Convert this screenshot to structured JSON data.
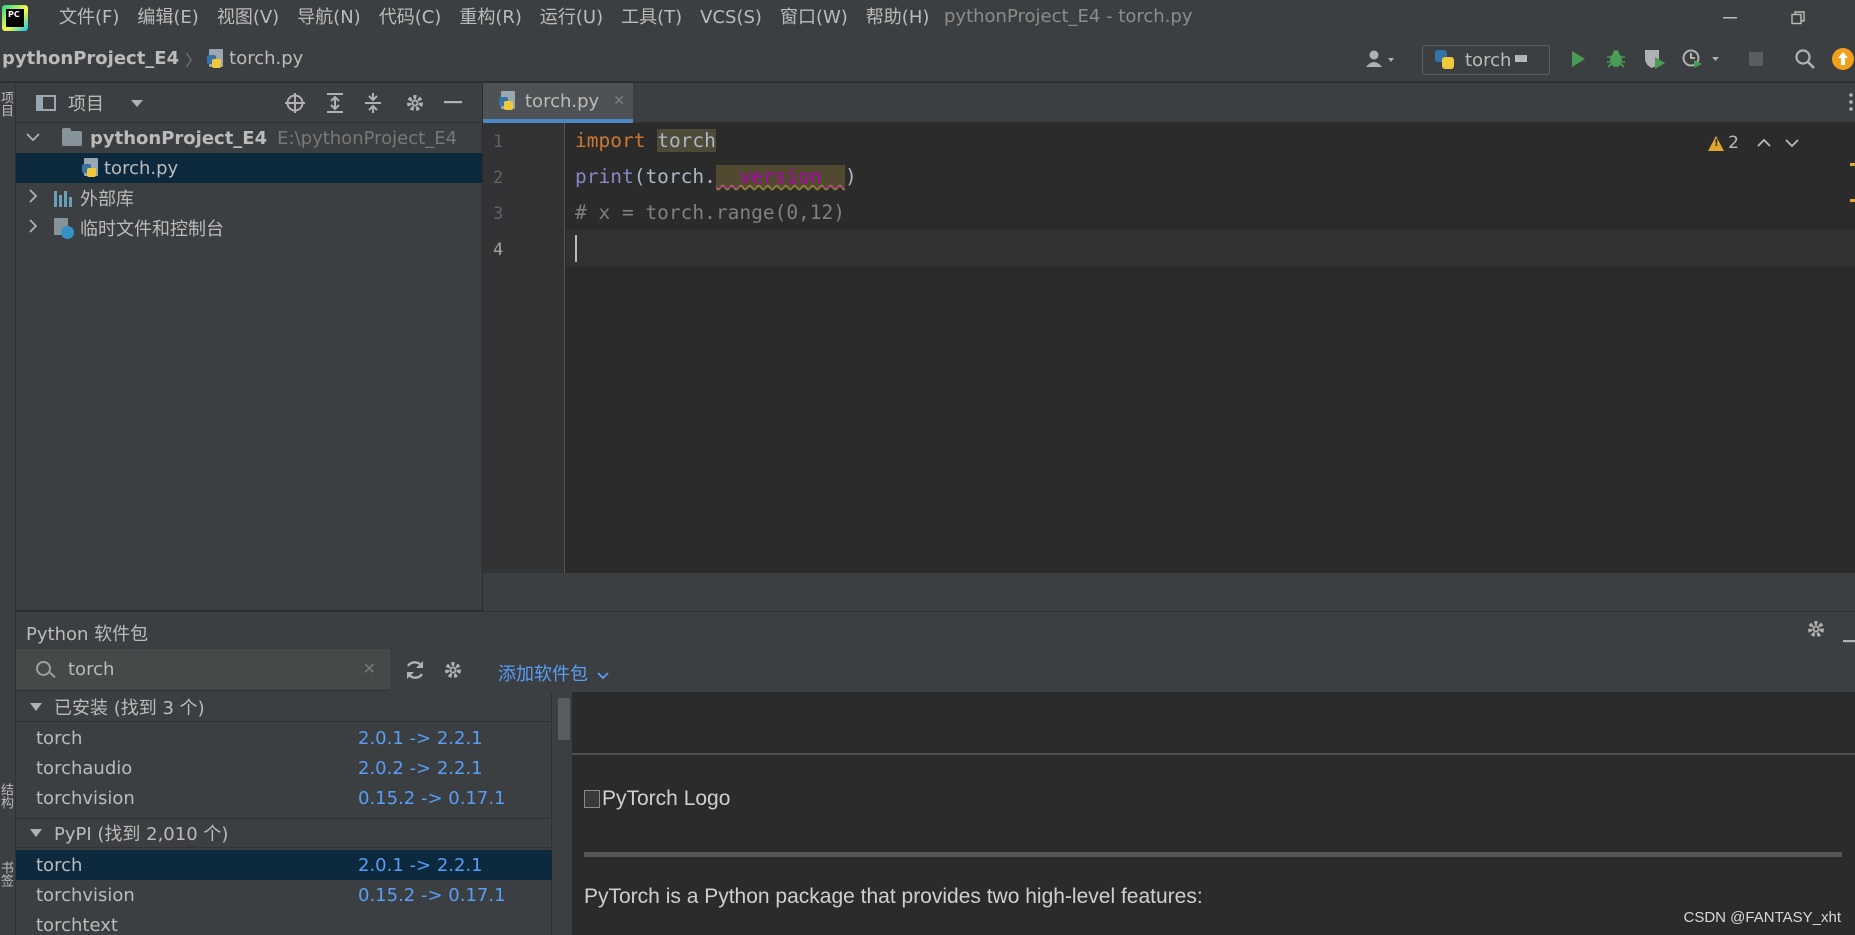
{
  "menubar": {
    "logo_text": "PC",
    "items": [
      "文件(F)",
      "编辑(E)",
      "视图(V)",
      "导航(N)",
      "代码(C)",
      "重构(R)",
      "运行(U)",
      "工具(T)",
      "VCS(S)",
      "窗口(W)",
      "帮助(H)"
    ],
    "window_title": "pythonProject_E4 - torch.py"
  },
  "navbar": {
    "project": "pythonProject_E4",
    "file": "torch.py",
    "run_config": "torch"
  },
  "left_strip": {
    "top_tab": "项目",
    "bottom_tab_1": "结构",
    "bottom_tab_2": "书签"
  },
  "project_panel": {
    "title": "项目",
    "root_name": "pythonProject_E4",
    "root_path": "E:\\pythonProject_E4",
    "file": "torch.py",
    "external_libs": "外部库",
    "scratches": "临时文件和控制台"
  },
  "editor": {
    "tab_name": "torch.py",
    "line_numbers": [
      "1",
      "2",
      "3",
      "4"
    ],
    "line1": {
      "kw": "import",
      "space": " ",
      "mod": "torch"
    },
    "line2": {
      "fn": "print",
      "open": "(torch.",
      "dunder": "__version__",
      "close": ")"
    },
    "line3": "# x = torch.range(0,12)",
    "warning_count": "2"
  },
  "packages": {
    "title": "Python 软件包",
    "search_value": "torch",
    "add_label": "添加软件包",
    "installed_group": "已安装 (找到 3 个)",
    "installed": [
      {
        "name": "torch",
        "version": "2.0.1 -> 2.2.1"
      },
      {
        "name": "torchaudio",
        "version": "2.0.2 -> 2.2.1"
      },
      {
        "name": "torchvision",
        "version": "0.15.2 -> 0.17.1"
      }
    ],
    "pypi_group": "PyPI (找到 2,010 个)",
    "pypi": [
      {
        "name": "torch",
        "version": "2.0.1 -> 2.2.1"
      },
      {
        "name": "torchvision",
        "version": "0.15.2 -> 0.17.1"
      },
      {
        "name": "torchtext",
        "version": ""
      }
    ],
    "detail_image_alt": "PyTorch Logo",
    "detail_text": "PyTorch is a Python package that provides two high-level features:"
  },
  "watermark": "CSDN @FANTASY_xht",
  "colors": {
    "accent": "#4a88c7",
    "link": "#589df6",
    "selection": "#0d293e",
    "keyword": "#cc7832",
    "warning": "#e0a92c",
    "run": "#499c54"
  }
}
